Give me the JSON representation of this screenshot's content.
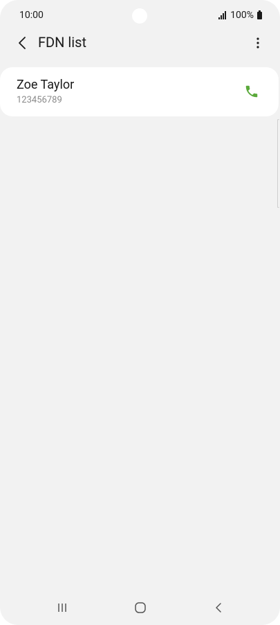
{
  "status_bar": {
    "time": "10:00",
    "battery": "100%",
    "icons": [
      "signal-icon",
      "battery-icon"
    ]
  },
  "app_bar": {
    "title": "FDN list",
    "back_icon": "chevron-left-icon",
    "more_icon": "more-vertical-icon"
  },
  "fdn_list": {
    "items": [
      {
        "name": "Zoe Taylor",
        "number": "123456789",
        "action_icon": "phone-icon"
      }
    ]
  },
  "navigation_bar": {
    "icons": [
      "recents-icon",
      "home-icon",
      "back-icon"
    ]
  },
  "colors": {
    "background": "#f2f2f2",
    "card": "#ffffff",
    "call_green": "#5aa93a",
    "text_primary": "#1a1a1a",
    "text_secondary": "#8a8a8a"
  }
}
